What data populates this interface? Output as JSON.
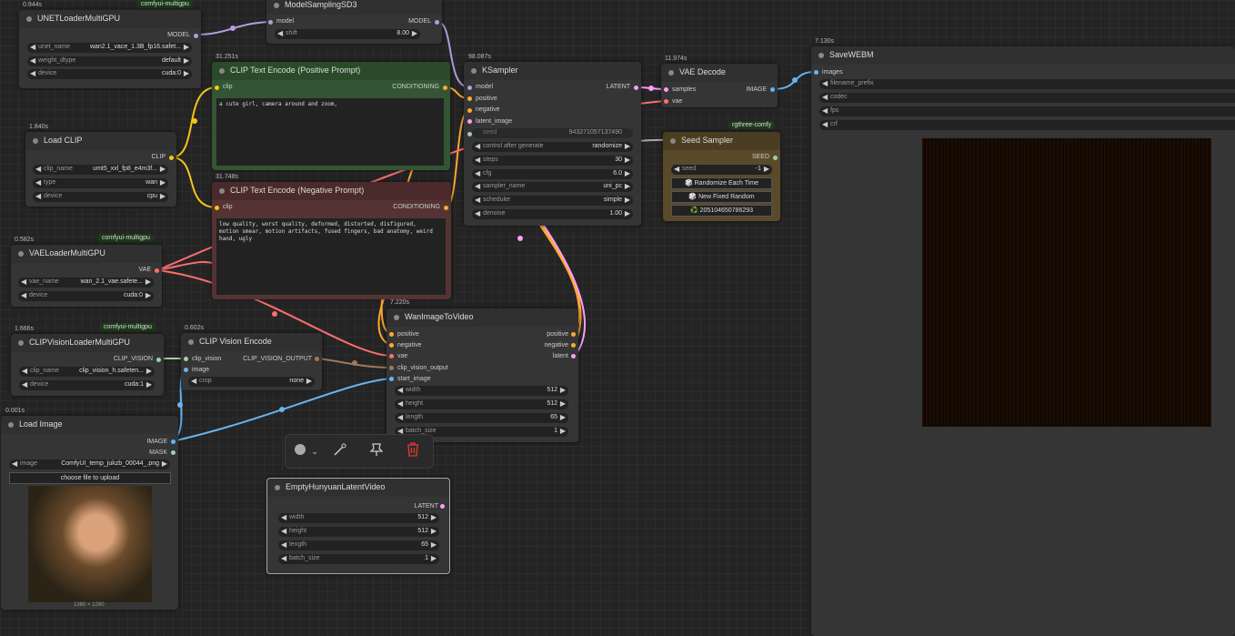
{
  "nodes": {
    "unet": {
      "timing": "0.944s",
      "badge": "comfyui-multigpu",
      "title": "UNETLoaderMultiGPU",
      "out": "MODEL",
      "w": [
        {
          "l": "unet_name",
          "v": "wan2.1_vace_1.3B_fp16.safet..."
        },
        {
          "l": "weight_dtype",
          "v": "default"
        },
        {
          "l": "device",
          "v": "cuda:0"
        }
      ]
    },
    "msd3": {
      "title": "ModelSamplingSD3",
      "in": "model",
      "out": "MODEL",
      "w": [
        {
          "l": "shift",
          "v": "8.00"
        }
      ]
    },
    "clip": {
      "timing": "1.840s",
      "title": "Load CLIP",
      "out": "CLIP",
      "w": [
        {
          "l": "clip_name",
          "v": "umt5_xxl_fp8_e4m3f..."
        },
        {
          "l": "type",
          "v": "wan"
        },
        {
          "l": "device",
          "v": "cpu"
        }
      ]
    },
    "pos": {
      "timing": "31.251s",
      "title": "CLIP Text Encode (Positive Prompt)",
      "in": "clip",
      "out": "CONDITIONING",
      "text": "a cute girl, camera around and zoom,"
    },
    "neg": {
      "timing": "31.748s",
      "title": "CLIP Text Encode (Negative Prompt)",
      "in": "clip",
      "out": "CONDITIONING",
      "text": "low quality, worst quality, deformed, distorted, disfigured,\nmotion smear, motion artifacts, fused fingers, bad anatomy, weird\nhand, ugly"
    },
    "ksampler": {
      "timing": "98.087s",
      "title": "KSampler",
      "out": "LATENT",
      "ins": [
        "model",
        "positive",
        "negative",
        "latent_image",
        "seed"
      ],
      "seed_value": "94327105713749​0",
      "w": [
        {
          "l": "control after generate",
          "v": "randomize"
        },
        {
          "l": "steps",
          "v": "30"
        },
        {
          "l": "cfg",
          "v": "6.0"
        },
        {
          "l": "sampler_name",
          "v": "uni_pc"
        },
        {
          "l": "scheduler",
          "v": "simple"
        },
        {
          "l": "denoise",
          "v": "1.00"
        }
      ]
    },
    "vaed": {
      "timing": "11.974s",
      "title": "VAE Decode",
      "ins": [
        "samples",
        "vae"
      ],
      "out": "IMAGE"
    },
    "seed": {
      "badge": "rgthree-comfy",
      "title": "Seed Sampler",
      "out": "SEED",
      "w": [
        {
          "l": "seed",
          "v": "-1"
        }
      ],
      "b1": "🎲 Randomize Each Time",
      "b2": "🎲 New Fixed Random",
      "b3": "♻️ 205104650786293"
    },
    "save": {
      "timing": "7.130s",
      "title": "SaveWEBM",
      "in": "images",
      "w": [
        {
          "l": "filename_prefix"
        },
        {
          "l": "codec"
        },
        {
          "l": "fps"
        },
        {
          "l": "crf"
        }
      ]
    },
    "vae": {
      "timing": "0.582s",
      "badge": "comfyui-multigpu",
      "title": "VAELoaderMultiGPU",
      "out": "VAE",
      "w": [
        {
          "l": "vae_name",
          "v": "wan_2.1_vae.safete..."
        },
        {
          "l": "device",
          "v": "cuda:0"
        }
      ]
    },
    "cvl": {
      "timing": "1.666s",
      "badge": "comfyui-multigpu",
      "title": "CLIPVisionLoaderMultiGPU",
      "out": "CLIP_VISION",
      "w": [
        {
          "l": "clip_name",
          "v": "clip_vision_h.safeten..."
        },
        {
          "l": "device",
          "v": "cuda:1"
        }
      ]
    },
    "cve": {
      "timing": "0.602s",
      "title": "CLIP Vision Encode",
      "ins": [
        "clip_vision",
        "image"
      ],
      "out": "CLIP_VISION_OUTPUT",
      "w": [
        {
          "l": "crop",
          "v": "none"
        }
      ]
    },
    "wan": {
      "timing": "7.220s",
      "title": "WanImageToVideo",
      "ins": [
        "positive",
        "negative",
        "vae",
        "clip_vision_output",
        "start_image"
      ],
      "outs": [
        "positive",
        "negative",
        "latent"
      ],
      "w": [
        {
          "l": "width",
          "v": "512"
        },
        {
          "l": "height",
          "v": "512"
        },
        {
          "l": "length",
          "v": "65"
        },
        {
          "l": "batch_size",
          "v": "1"
        }
      ]
    },
    "load": {
      "timing": "0.001s",
      "title": "Load Image",
      "outs": [
        "IMAGE",
        "MASK"
      ],
      "w": [
        {
          "l": "image",
          "v": "ComfyUI_temp_jukzb_00044_.png"
        }
      ],
      "upload": "choose file to upload",
      "dims": "1360 × 1280"
    },
    "hyl": {
      "title": "EmptyHunyuanLatentVideo",
      "out": "LATENT",
      "w": [
        {
          "l": "width",
          "v": "512"
        },
        {
          "l": "height",
          "v": "512"
        },
        {
          "l": "length",
          "v": "65"
        },
        {
          "l": "batch_size",
          "v": "1"
        }
      ]
    }
  },
  "toolbar": {
    "icons": [
      "color-circle-icon",
      "chevron-down-icon",
      "bypass-wand-icon",
      "pin-icon",
      "delete-trash-icon"
    ]
  },
  "colors": {
    "clip": "#f5c518",
    "model": "#b39ddb",
    "vae": "#ff6e6e",
    "cond": "#ffa931",
    "latent": "#ff9cf9",
    "image": "#64b5f6",
    "clipvision": "#a1cfa8",
    "delete": "#e53935"
  }
}
